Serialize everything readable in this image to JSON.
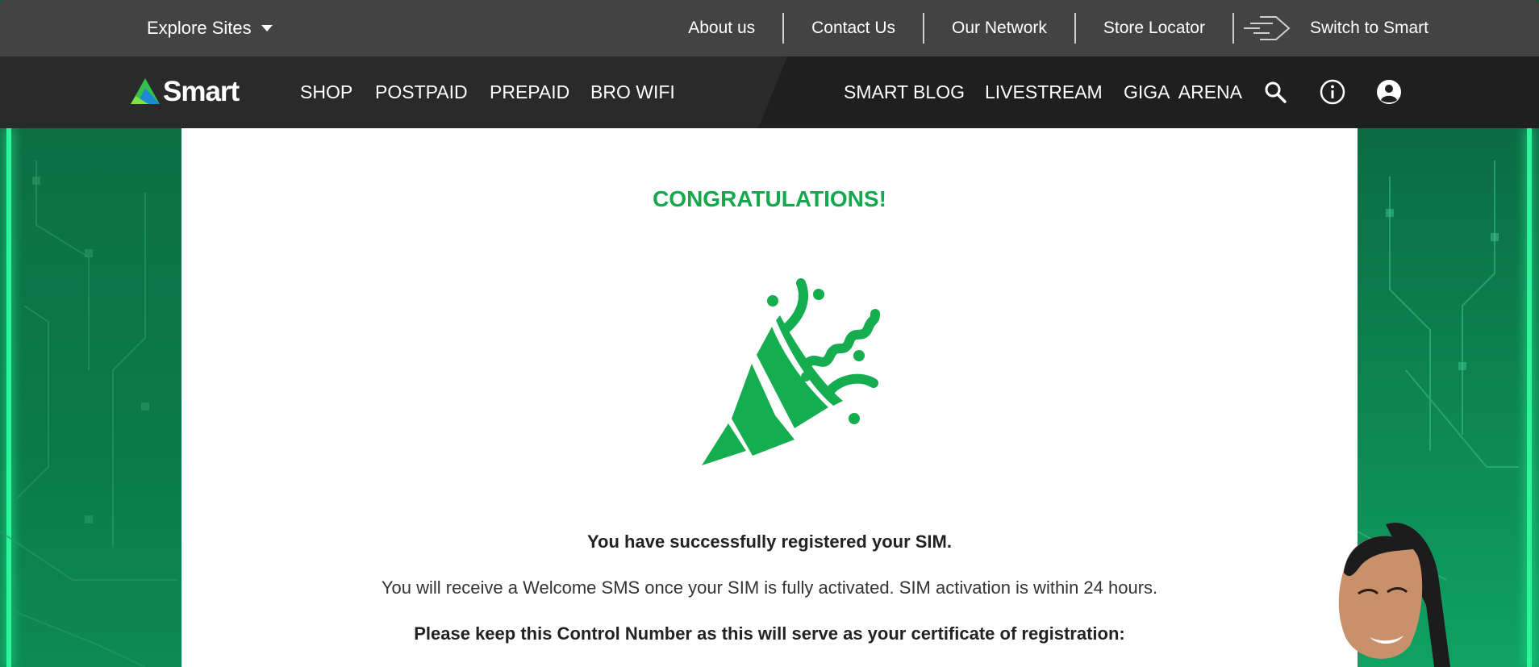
{
  "topbar": {
    "explore_label": "Explore Sites",
    "links": [
      "About us",
      "Contact Us",
      "Our Network",
      "Store Locator"
    ],
    "switch_label": "Switch to Smart"
  },
  "nav": {
    "logo_text": "Smart",
    "left_items": [
      "SHOP",
      "POSTPAID",
      "PREPAID",
      "BRO WIFI"
    ],
    "right_items": [
      "SMART BLOG",
      "LIVESTREAM",
      "GIGA  ARENA"
    ],
    "icons": [
      "search-icon",
      "info-icon",
      "account-icon"
    ]
  },
  "content": {
    "title": "CONGRATULATIONS!",
    "illustration": "party-popper-icon",
    "success_message": "You have successfully registered your SIM.",
    "info_message": "You will receive a Welcome SMS once your SIM is fully activated. SIM activation is within 24 hours.",
    "control_message": "Please keep this Control Number as this will serve as your certificate of registration:"
  },
  "colors": {
    "brand_green": "#14a84d",
    "topbar_bg": "#434343",
    "nav_bg": "#2a2a2a"
  }
}
